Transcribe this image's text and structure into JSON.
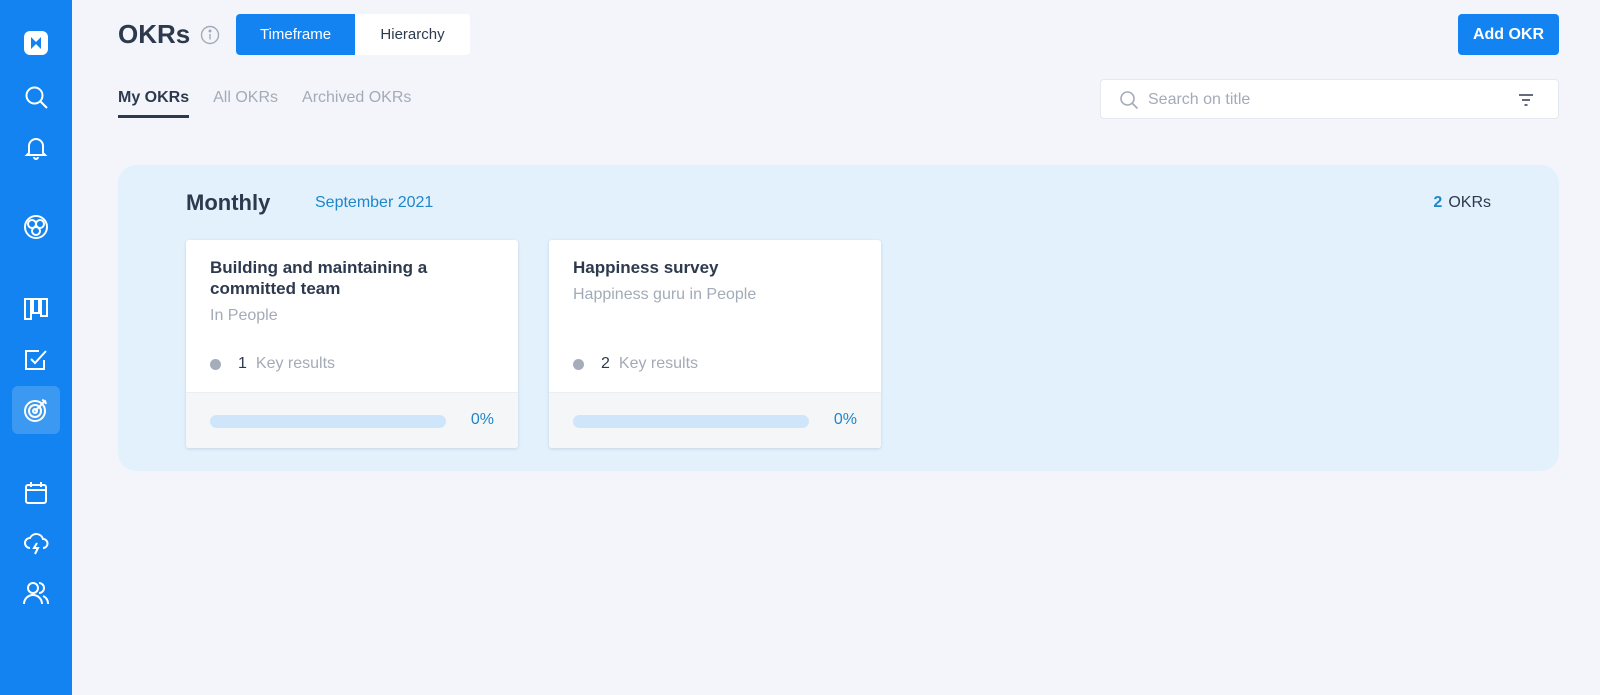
{
  "sidebar": {
    "items": [
      {
        "icon": "logo-icon"
      },
      {
        "icon": "search-icon"
      },
      {
        "icon": "bell-icon"
      },
      {
        "icon": "globe-icon"
      },
      {
        "icon": "kanban-icon"
      },
      {
        "icon": "checkbox-icon"
      },
      {
        "icon": "target-icon",
        "active": true
      },
      {
        "icon": "calendar-icon"
      },
      {
        "icon": "cloud-lightning-icon"
      },
      {
        "icon": "users-icon"
      }
    ]
  },
  "header": {
    "title": "OKRs",
    "view_toggle": [
      "Timeframe",
      "Hierarchy"
    ],
    "active_view": "Timeframe",
    "add_label": "Add OKR"
  },
  "tabs": [
    {
      "label": "My OKRs",
      "active": true
    },
    {
      "label": "All OKRs",
      "active": false
    },
    {
      "label": "Archived OKRs",
      "active": false
    }
  ],
  "search": {
    "placeholder": "Search on title",
    "value": ""
  },
  "group": {
    "title": "Monthly",
    "period": "September 2021",
    "count": "2",
    "count_label": "OKRs"
  },
  "cards": [
    {
      "title": "Building and maintaining a committed team",
      "subtitle": "In People",
      "key_results_count": "1",
      "key_results_label": "Key results",
      "progress": 0,
      "progress_label": "0%"
    },
    {
      "title": "Happiness survey",
      "subtitle": "Happiness guru in People",
      "key_results_count": "2",
      "key_results_label": "Key results",
      "progress": 0,
      "progress_label": "0%"
    }
  ],
  "colors": {
    "primary": "#1283f0",
    "text": "#2d3a4e",
    "muted": "#a3abb8",
    "accent_text": "#1f86c9",
    "panel": "#e3f1fd"
  }
}
